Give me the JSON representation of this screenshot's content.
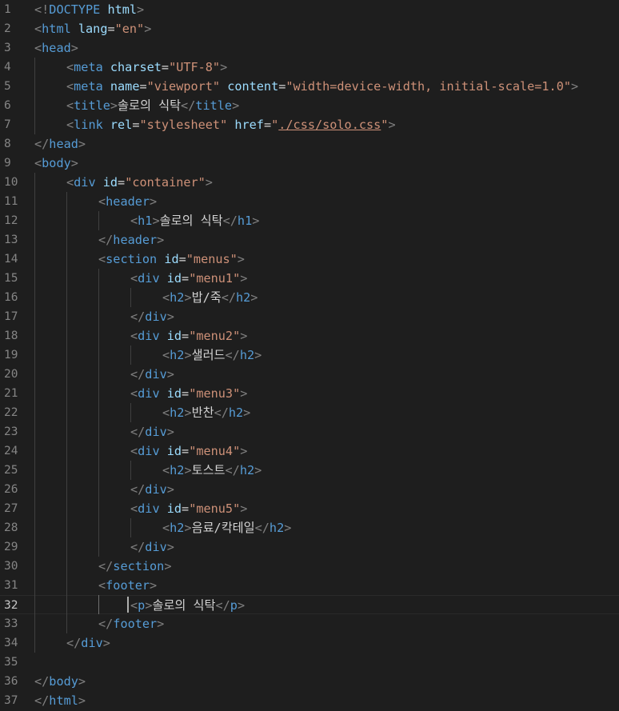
{
  "editor": {
    "language": "html",
    "current_line": 32,
    "lines": [
      {
        "n": "1",
        "indent": 0,
        "tokens": [
          [
            "p",
            "<!"
          ],
          [
            "t",
            "DOCTYPE"
          ],
          [
            "x",
            " "
          ],
          [
            "a",
            "html"
          ],
          [
            "p",
            ">"
          ]
        ]
      },
      {
        "n": "2",
        "indent": 0,
        "tokens": [
          [
            "p",
            "<"
          ],
          [
            "t",
            "html"
          ],
          [
            "x",
            " "
          ],
          [
            "a",
            "lang"
          ],
          [
            "x",
            "="
          ],
          [
            "s",
            "\"en\""
          ],
          [
            "p",
            ">"
          ]
        ]
      },
      {
        "n": "3",
        "indent": 0,
        "tokens": [
          [
            "p",
            "<"
          ],
          [
            "t",
            "head"
          ],
          [
            "p",
            ">"
          ]
        ]
      },
      {
        "n": "4",
        "indent": 1,
        "tokens": [
          [
            "p",
            "<"
          ],
          [
            "t",
            "meta"
          ],
          [
            "x",
            " "
          ],
          [
            "a",
            "charset"
          ],
          [
            "x",
            "="
          ],
          [
            "s",
            "\"UTF-8\""
          ],
          [
            "p",
            ">"
          ]
        ]
      },
      {
        "n": "5",
        "indent": 1,
        "tokens": [
          [
            "p",
            "<"
          ],
          [
            "t",
            "meta"
          ],
          [
            "x",
            " "
          ],
          [
            "a",
            "name"
          ],
          [
            "x",
            "="
          ],
          [
            "s",
            "\"viewport\""
          ],
          [
            "x",
            " "
          ],
          [
            "a",
            "content"
          ],
          [
            "x",
            "="
          ],
          [
            "s",
            "\"width=device-width, initial-scale=1.0\""
          ],
          [
            "p",
            ">"
          ]
        ]
      },
      {
        "n": "6",
        "indent": 1,
        "tokens": [
          [
            "p",
            "<"
          ],
          [
            "t",
            "title"
          ],
          [
            "p",
            ">"
          ],
          [
            "x",
            "솔로의 식탁"
          ],
          [
            "p",
            "</"
          ],
          [
            "t",
            "title"
          ],
          [
            "p",
            ">"
          ]
        ]
      },
      {
        "n": "7",
        "indent": 1,
        "tokens": [
          [
            "p",
            "<"
          ],
          [
            "t",
            "link"
          ],
          [
            "x",
            " "
          ],
          [
            "a",
            "rel"
          ],
          [
            "x",
            "="
          ],
          [
            "s",
            "\"stylesheet\""
          ],
          [
            "x",
            " "
          ],
          [
            "a",
            "href"
          ],
          [
            "x",
            "="
          ],
          [
            "s",
            "\""
          ],
          [
            "su",
            "./css/solo.css"
          ],
          [
            "s",
            "\""
          ],
          [
            "p",
            ">"
          ]
        ]
      },
      {
        "n": "8",
        "indent": 0,
        "tokens": [
          [
            "p",
            "</"
          ],
          [
            "t",
            "head"
          ],
          [
            "p",
            ">"
          ]
        ]
      },
      {
        "n": "9",
        "indent": 0,
        "tokens": [
          [
            "p",
            "<"
          ],
          [
            "t",
            "body"
          ],
          [
            "p",
            ">"
          ]
        ]
      },
      {
        "n": "10",
        "indent": 1,
        "tokens": [
          [
            "p",
            "<"
          ],
          [
            "t",
            "div"
          ],
          [
            "x",
            " "
          ],
          [
            "a",
            "id"
          ],
          [
            "x",
            "="
          ],
          [
            "s",
            "\"container\""
          ],
          [
            "p",
            ">"
          ]
        ]
      },
      {
        "n": "11",
        "indent": 2,
        "tokens": [
          [
            "p",
            "<"
          ],
          [
            "t",
            "header"
          ],
          [
            "p",
            ">"
          ]
        ]
      },
      {
        "n": "12",
        "indent": 3,
        "tokens": [
          [
            "p",
            "<"
          ],
          [
            "t",
            "h1"
          ],
          [
            "p",
            ">"
          ],
          [
            "x",
            "솔로의 식탁"
          ],
          [
            "p",
            "</"
          ],
          [
            "t",
            "h1"
          ],
          [
            "p",
            ">"
          ]
        ]
      },
      {
        "n": "13",
        "indent": 2,
        "tokens": [
          [
            "p",
            "</"
          ],
          [
            "t",
            "header"
          ],
          [
            "p",
            ">"
          ]
        ]
      },
      {
        "n": "14",
        "indent": 2,
        "tokens": [
          [
            "p",
            "<"
          ],
          [
            "t",
            "section"
          ],
          [
            "x",
            " "
          ],
          [
            "a",
            "id"
          ],
          [
            "x",
            "="
          ],
          [
            "s",
            "\"menus\""
          ],
          [
            "p",
            ">"
          ]
        ]
      },
      {
        "n": "15",
        "indent": 3,
        "tokens": [
          [
            "p",
            "<"
          ],
          [
            "t",
            "div"
          ],
          [
            "x",
            " "
          ],
          [
            "a",
            "id"
          ],
          [
            "x",
            "="
          ],
          [
            "s",
            "\"menu1\""
          ],
          [
            "p",
            ">"
          ]
        ]
      },
      {
        "n": "16",
        "indent": 4,
        "tokens": [
          [
            "p",
            "<"
          ],
          [
            "t",
            "h2"
          ],
          [
            "p",
            ">"
          ],
          [
            "x",
            "밥/죽"
          ],
          [
            "p",
            "</"
          ],
          [
            "t",
            "h2"
          ],
          [
            "p",
            ">"
          ]
        ]
      },
      {
        "n": "17",
        "indent": 3,
        "tokens": [
          [
            "p",
            "</"
          ],
          [
            "t",
            "div"
          ],
          [
            "p",
            ">"
          ]
        ]
      },
      {
        "n": "18",
        "indent": 3,
        "tokens": [
          [
            "p",
            "<"
          ],
          [
            "t",
            "div"
          ],
          [
            "x",
            " "
          ],
          [
            "a",
            "id"
          ],
          [
            "x",
            "="
          ],
          [
            "s",
            "\"menu2\""
          ],
          [
            "p",
            ">"
          ]
        ]
      },
      {
        "n": "19",
        "indent": 4,
        "tokens": [
          [
            "p",
            "<"
          ],
          [
            "t",
            "h2"
          ],
          [
            "p",
            ">"
          ],
          [
            "x",
            "샐러드"
          ],
          [
            "p",
            "</"
          ],
          [
            "t",
            "h2"
          ],
          [
            "p",
            ">"
          ]
        ]
      },
      {
        "n": "20",
        "indent": 3,
        "tokens": [
          [
            "p",
            "</"
          ],
          [
            "t",
            "div"
          ],
          [
            "p",
            ">"
          ]
        ]
      },
      {
        "n": "21",
        "indent": 3,
        "tokens": [
          [
            "p",
            "<"
          ],
          [
            "t",
            "div"
          ],
          [
            "x",
            " "
          ],
          [
            "a",
            "id"
          ],
          [
            "x",
            "="
          ],
          [
            "s",
            "\"menu3\""
          ],
          [
            "p",
            ">"
          ]
        ]
      },
      {
        "n": "22",
        "indent": 4,
        "tokens": [
          [
            "p",
            "<"
          ],
          [
            "t",
            "h2"
          ],
          [
            "p",
            ">"
          ],
          [
            "x",
            "반찬"
          ],
          [
            "p",
            "</"
          ],
          [
            "t",
            "h2"
          ],
          [
            "p",
            ">"
          ]
        ]
      },
      {
        "n": "23",
        "indent": 3,
        "tokens": [
          [
            "p",
            "</"
          ],
          [
            "t",
            "div"
          ],
          [
            "p",
            ">"
          ]
        ]
      },
      {
        "n": "24",
        "indent": 3,
        "tokens": [
          [
            "p",
            "<"
          ],
          [
            "t",
            "div"
          ],
          [
            "x",
            " "
          ],
          [
            "a",
            "id"
          ],
          [
            "x",
            "="
          ],
          [
            "s",
            "\"menu4\""
          ],
          [
            "p",
            ">"
          ]
        ]
      },
      {
        "n": "25",
        "indent": 4,
        "tokens": [
          [
            "p",
            "<"
          ],
          [
            "t",
            "h2"
          ],
          [
            "p",
            ">"
          ],
          [
            "x",
            "토스트"
          ],
          [
            "p",
            "</"
          ],
          [
            "t",
            "h2"
          ],
          [
            "p",
            ">"
          ]
        ]
      },
      {
        "n": "26",
        "indent": 3,
        "tokens": [
          [
            "p",
            "</"
          ],
          [
            "t",
            "div"
          ],
          [
            "p",
            ">"
          ]
        ]
      },
      {
        "n": "27",
        "indent": 3,
        "tokens": [
          [
            "p",
            "<"
          ],
          [
            "t",
            "div"
          ],
          [
            "x",
            " "
          ],
          [
            "a",
            "id"
          ],
          [
            "x",
            "="
          ],
          [
            "s",
            "\"menu5\""
          ],
          [
            "p",
            ">"
          ]
        ]
      },
      {
        "n": "28",
        "indent": 4,
        "tokens": [
          [
            "p",
            "<"
          ],
          [
            "t",
            "h2"
          ],
          [
            "p",
            ">"
          ],
          [
            "x",
            "음료/칵테일"
          ],
          [
            "p",
            "</"
          ],
          [
            "t",
            "h2"
          ],
          [
            "p",
            ">"
          ]
        ]
      },
      {
        "n": "29",
        "indent": 3,
        "tokens": [
          [
            "p",
            "</"
          ],
          [
            "t",
            "div"
          ],
          [
            "p",
            ">"
          ]
        ]
      },
      {
        "n": "30",
        "indent": 2,
        "tokens": [
          [
            "p",
            "</"
          ],
          [
            "t",
            "section"
          ],
          [
            "p",
            ">"
          ]
        ]
      },
      {
        "n": "31",
        "indent": 2,
        "tokens": [
          [
            "p",
            "<"
          ],
          [
            "t",
            "footer"
          ],
          [
            "p",
            ">"
          ]
        ]
      },
      {
        "n": "32",
        "indent": 3,
        "tokens": [
          [
            "p",
            "<"
          ],
          [
            "t",
            "p"
          ],
          [
            "p",
            ">"
          ],
          [
            "x",
            "솔로의 식탁"
          ],
          [
            "p",
            "</"
          ],
          [
            "t",
            "p"
          ],
          [
            "p",
            ">"
          ]
        ]
      },
      {
        "n": "33",
        "indent": 2,
        "tokens": [
          [
            "p",
            "</"
          ],
          [
            "t",
            "footer"
          ],
          [
            "p",
            ">"
          ]
        ]
      },
      {
        "n": "34",
        "indent": 1,
        "tokens": [
          [
            "p",
            "</"
          ],
          [
            "t",
            "div"
          ],
          [
            "p",
            ">"
          ]
        ]
      },
      {
        "n": "35",
        "indent": 0,
        "tokens": []
      },
      {
        "n": "36",
        "indent": 0,
        "tokens": [
          [
            "p",
            "</"
          ],
          [
            "t",
            "body"
          ],
          [
            "p",
            ">"
          ]
        ]
      },
      {
        "n": "37",
        "indent": 0,
        "tokens": [
          [
            "p",
            "</"
          ],
          [
            "t",
            "html"
          ],
          [
            "p",
            ">"
          ]
        ]
      }
    ]
  },
  "colors": {
    "background": "#1e1e1e",
    "tag": "#569cd6",
    "attribute": "#9cdcfe",
    "string": "#ce9178",
    "punctuation": "#808080",
    "text": "#d4d4d4",
    "line_number": "#858585"
  }
}
